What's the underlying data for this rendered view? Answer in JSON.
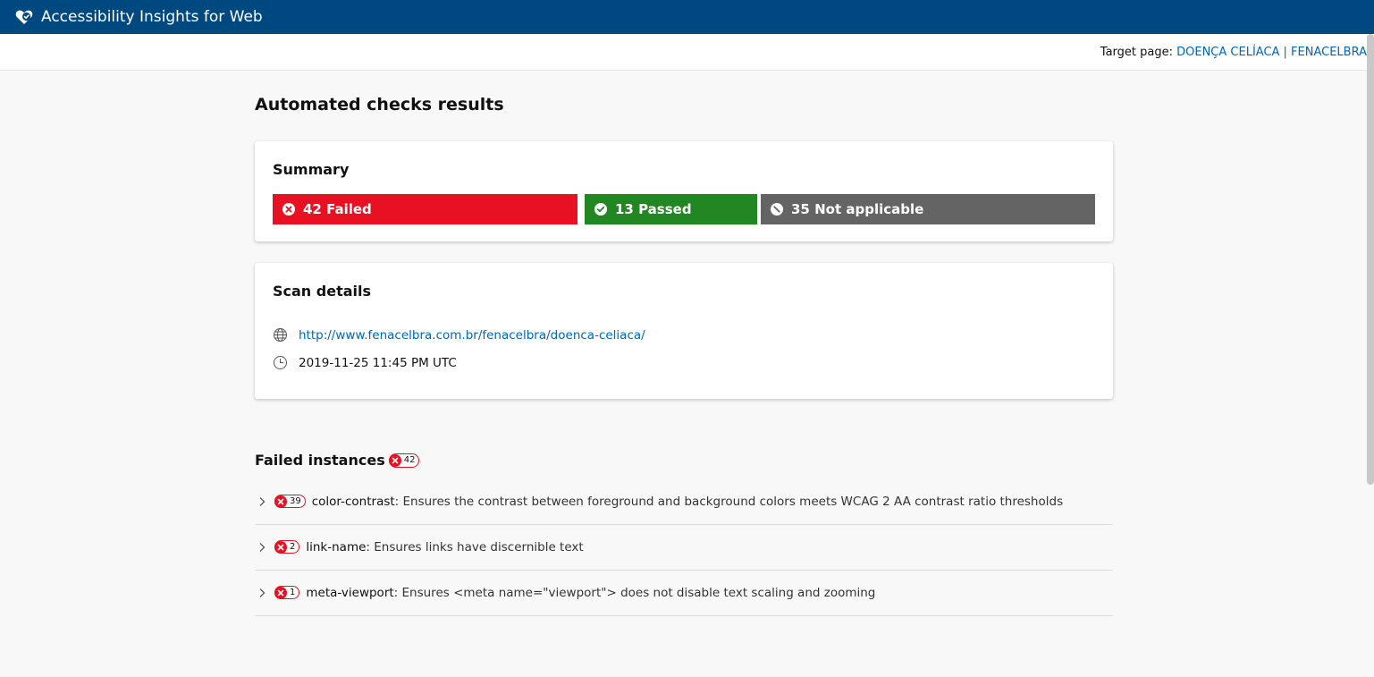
{
  "app": {
    "title": "Accessibility Insights for Web",
    "brand_color": "#004880",
    "logo_icon": "heart-check-logo-icon"
  },
  "target": {
    "label": "Target page: ",
    "link": "DOENÇA CELÍACA | FENACELBRA"
  },
  "heading": "Automated checks results",
  "summary": {
    "title": "Summary",
    "failed": {
      "label": "42 Failed",
      "color": "#e81123",
      "icon": "failed-x-icon"
    },
    "passed": {
      "label": "13 Passed",
      "color": "#228722",
      "icon": "passed-check-icon"
    },
    "not_applicable": {
      "label": "35 Not applicable",
      "color": "#646464",
      "icon": "not-applicable-icon"
    }
  },
  "scan_details": {
    "title": "Scan details",
    "url": "http://www.fenacelbra.com.br/fenacelbra/doenca-celiaca/",
    "timestamp": "2019-11-25 11:45 PM UTC"
  },
  "failed_instances": {
    "title": "Failed instances",
    "count": "42",
    "rules": [
      {
        "count": "39",
        "id": "color-contrast",
        "description": ": Ensures the contrast between foreground and background colors meets WCAG 2 AA contrast ratio thresholds"
      },
      {
        "count": "2",
        "id": "link-name",
        "description": ": Ensures links have discernible text"
      },
      {
        "count": "1",
        "id": "meta-viewport",
        "description": ": Ensures <meta name=\"viewport\"> does not disable text scaling and zooming"
      }
    ]
  }
}
